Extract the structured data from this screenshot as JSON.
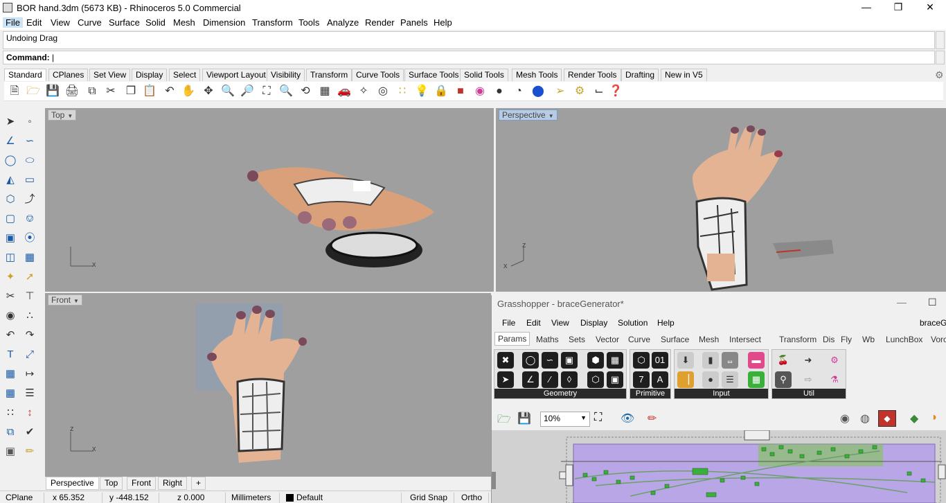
{
  "window": {
    "title": "BOR hand.3dm (5673 KB) - Rhinoceros 5.0 Commercial"
  },
  "menu": [
    "File",
    "Edit",
    "View",
    "Curve",
    "Surface",
    "Solid",
    "Mesh",
    "Dimension",
    "Transform",
    "Tools",
    "Analyze",
    "Render",
    "Panels",
    "Help"
  ],
  "command": {
    "history": "Undoing Drag",
    "prompt": "Command:"
  },
  "toolbar_tabs": [
    "Standard",
    "CPlanes",
    "Set View",
    "Display",
    "Select",
    "Viewport Layout",
    "Visibility",
    "Transform",
    "Curve Tools",
    "Surface Tools",
    "Solid Tools",
    "Mesh Tools",
    "Render Tools",
    "Drafting",
    "New in V5"
  ],
  "viewports": {
    "top": {
      "label": "Top",
      "axis_x": "x"
    },
    "perspective": {
      "label": "Perspective",
      "axis_x": "x",
      "axis_z": "z"
    },
    "front": {
      "label": "Front",
      "axis_x": "x",
      "axis_z": "z"
    }
  },
  "viewport_tabs": [
    "Perspective",
    "Top",
    "Front",
    "Right",
    "+"
  ],
  "status": {
    "cplane": "CPlane",
    "x": "x 65.352",
    "y": "y -448.152",
    "z": "z 0.000",
    "units": "Millimeters",
    "layer": "Default",
    "grid_snap": "Grid Snap",
    "ortho": "Ortho"
  },
  "grasshopper": {
    "title": "Grasshopper - braceGenerator*",
    "doc_name": "braceGe",
    "menu": [
      "File",
      "Edit",
      "View",
      "Display",
      "Solution",
      "Help"
    ],
    "tabs": [
      "Params",
      "Maths",
      "Sets",
      "Vector",
      "Curve",
      "Surface",
      "Mesh",
      "Intersect",
      "Transform",
      "Dis",
      "Fly",
      "Wb",
      "LunchBox",
      "Voro"
    ],
    "panels": [
      "Geometry",
      "Primitive",
      "Input",
      "Util"
    ],
    "zoom": "10%"
  },
  "colors": {
    "viewport_bg": "#9f9f9f",
    "gh_canvas": "#d1d1d1",
    "gh_group": "#b9a6e6",
    "gh_green": "#7ec850"
  }
}
